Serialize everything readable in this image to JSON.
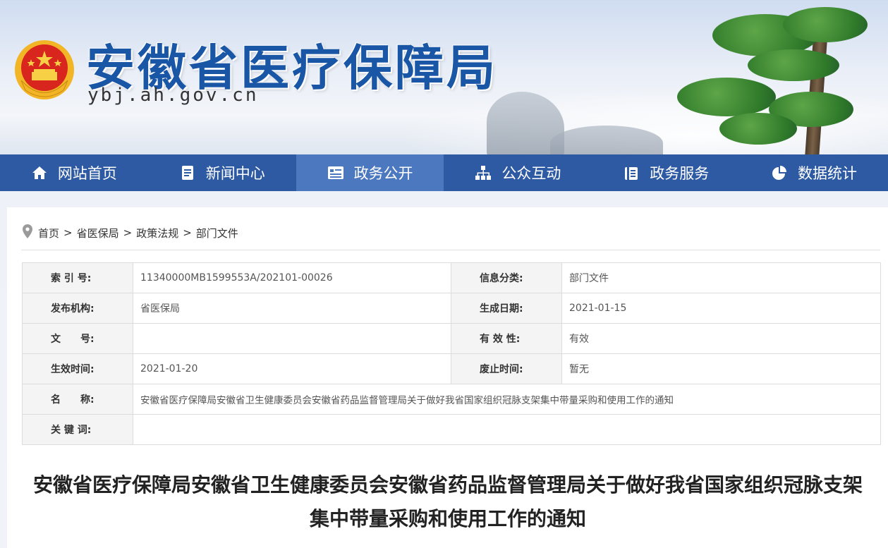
{
  "header": {
    "title": "安徽省医疗保障局",
    "domain": "ybj.ah.gov.cn"
  },
  "nav": [
    {
      "label": "网站首页",
      "icon": "home-icon",
      "active": false
    },
    {
      "label": "新闻中心",
      "icon": "document-icon",
      "active": false
    },
    {
      "label": "政务公开",
      "icon": "list-icon",
      "active": true
    },
    {
      "label": "公众互动",
      "icon": "network-icon",
      "active": false
    },
    {
      "label": "政务服务",
      "icon": "clipboard-icon",
      "active": false
    },
    {
      "label": "数据统计",
      "icon": "pie-chart-icon",
      "active": false
    }
  ],
  "breadcrumb": [
    "首页",
    "省医保局",
    "政策法规",
    "部门文件"
  ],
  "breadcrumb_sep": ">",
  "info": {
    "index_label": "索 引 号:",
    "index_value": "11340000MB1599553A/202101-00026",
    "category_label": "信息分类:",
    "category_value": "部门文件",
    "publisher_label": "发布机构:",
    "publisher_value": "省医保局",
    "created_label": "生成日期:",
    "created_value": "2021-01-15",
    "docno_label": "文　　号:",
    "docno_value": "",
    "validity_label": "有 效 性:",
    "validity_value": "有效",
    "effective_label": "生效时间:",
    "effective_value": "2021-01-20",
    "abolish_label": "废止时间:",
    "abolish_value": "暂无",
    "name_label": "名　　称:",
    "name_value": "安徽省医疗保障局安徽省卫生健康委员会安徽省药品监督管理局关于做好我省国家组织冠脉支架集中带量采购和使用工作的通知",
    "keywords_label": "关 键 词:",
    "keywords_value": ""
  },
  "document": {
    "title": "安徽省医疗保障局安徽省卫生健康委员会安徽省药品监督管理局关于做好我省国家组织冠脉支架集中带量采购和使用工作的通知"
  },
  "colors": {
    "nav_bg": "#2e5aa3",
    "nav_active": "#4b78bf",
    "title_blue": "#1a56a6"
  }
}
